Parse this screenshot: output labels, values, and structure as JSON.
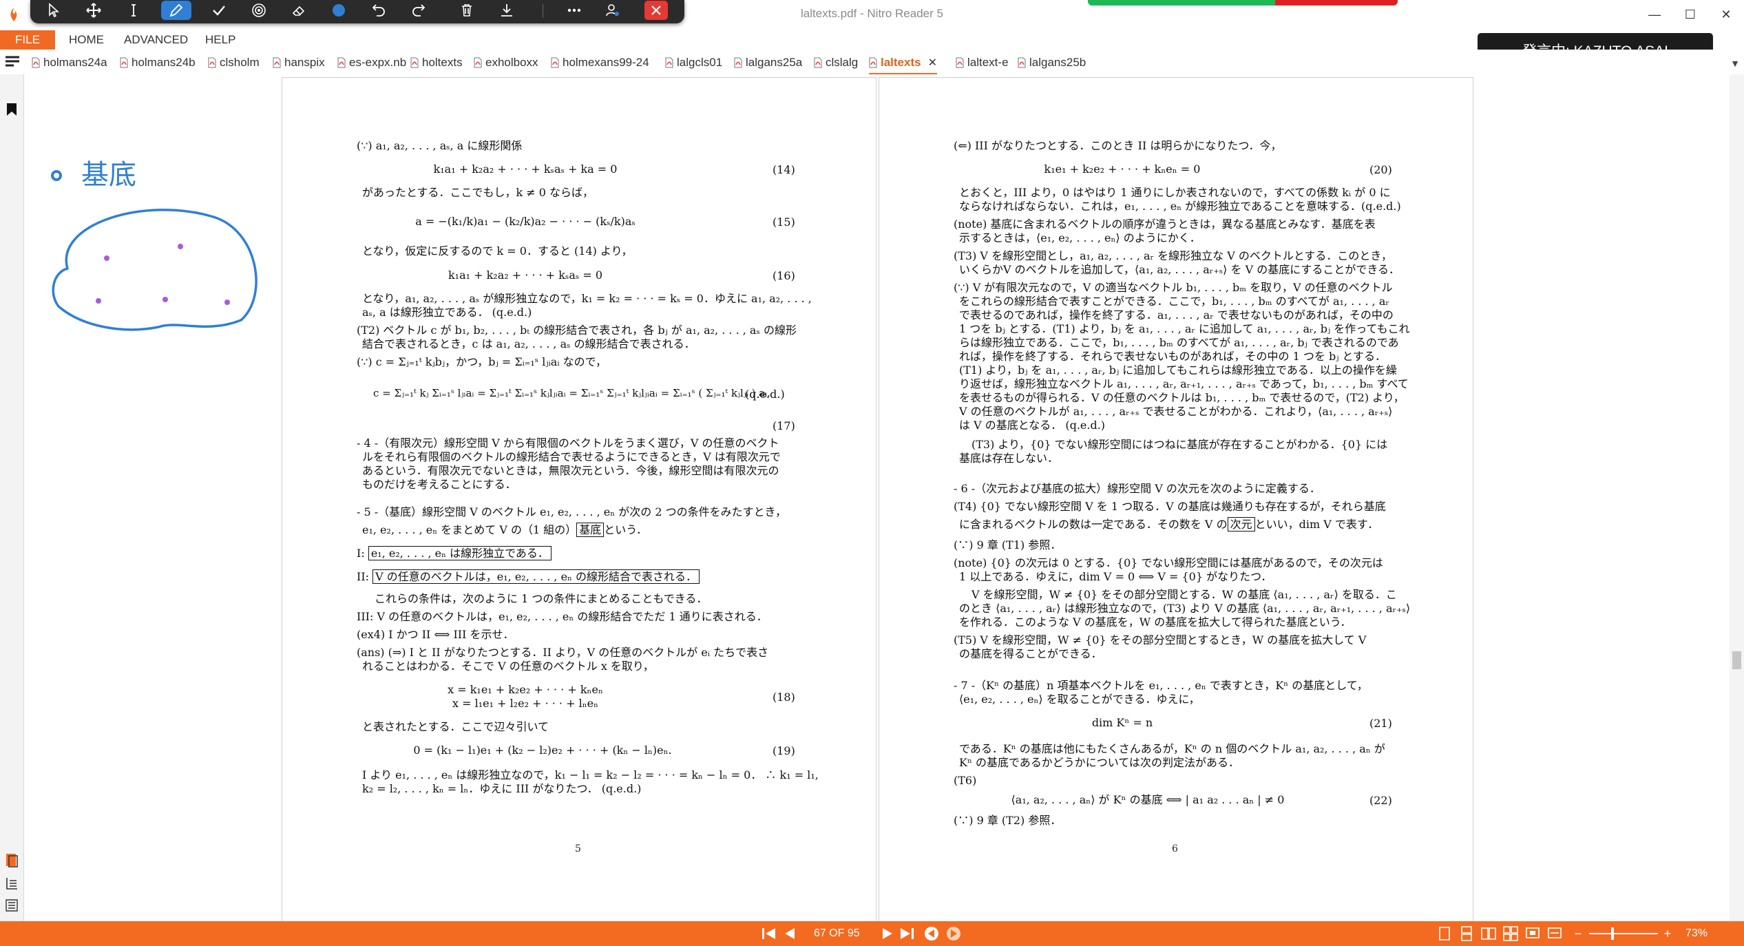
{
  "window": {
    "title": "laltexts.pdf - Nitro Reader 5",
    "min": "—",
    "max": "☐",
    "close": "✕"
  },
  "menu": {
    "file": "FILE",
    "home": "HOME",
    "advanced": "ADVANCED",
    "help": "HELP"
  },
  "tabs": [
    "holmans24a",
    "holmans24b",
    "clsholm",
    "hanspix",
    "es-expx.nb",
    "holtexts",
    "exholboxx",
    "holmexans99-24",
    "lalgcls01",
    "lalgans25a",
    "clslalg",
    "laltexts",
    "laltext-e",
    "lalgans25b"
  ],
  "active_tab": "laltexts",
  "speaker": "発言中: KAZUTO ASAI",
  "annotation": {
    "handwriting": "基底"
  },
  "page5": {
    "l1": "(∵) a₁, a₂, . . . , aₛ, a に線形関係",
    "eq14": "k₁a₁ + k₂a₂ + · · · + kₛaₛ + ka = 0",
    "n14": "(14)",
    "l2": "があったとする．ここでもし，k ≠ 0 ならば，",
    "eq15": "a = −(k₁/k)a₁ − (k₂/k)a₂ − · · · − (kₛ/k)aₛ",
    "n15": "(15)",
    "l3": "となり，仮定に反するので k = 0．すると (14) より，",
    "eq16": "k₁a₁ + k₂a₂ + · · · + kₛaₛ = 0",
    "n16": "(16)",
    "l4": "となり，a₁, a₂, . . . , aₛ が線形独立なので，k₁ = k₂ = · · · = kₛ = 0．ゆえに a₁, a₂, . . . ,",
    "l5": "aₛ, a は線形独立である．  (q.e.d.)",
    "l6": "(T2) ベクトル c が b₁, b₂, . . . , bₜ の線形結合で表され，各 bⱼ が a₁, a₂, . . . , aₛ の線形",
    "l7": "結合で表されるとき，c は a₁, a₂, . . . , aₛ の線形結合で表される．",
    "l8": "(∵) c = Σⱼ₌₁ᵗ kⱼbⱼ，かつ，bⱼ = Σᵢ₌₁ˢ lⱼᵢaᵢ なので，",
    "eq17": "c = Σⱼ₌₁ᵗ kⱼ Σᵢ₌₁ˢ lⱼᵢaᵢ = Σⱼ₌₁ᵗ Σᵢ₌₁ˢ kⱼlⱼᵢaᵢ = Σᵢ₌₁ˢ Σⱼ₌₁ᵗ kⱼlⱼᵢaᵢ = Σᵢ₌₁ˢ ( Σⱼ₌₁ᵗ kⱼlⱼᵢ ) aᵢ.",
    "qed17": "(q.e.d.)",
    "n17": "(17)",
    "s4a": "- 4 -（有限次元）線形空間 V から有限個のベクトルをうまく選び，V の任意のベクト",
    "s4b": "ルをそれら有限個のベクトルの線形結合で表せるようにできるとき，V は有限次元で",
    "s4c": "あるという．有限次元でないときは，無限次元という．今後，線形空間は有限次元の",
    "s4d": "ものだけを考えることにする．",
    "s5a": "- 5 -（基底）線形空間 V のベクトル e₁, e₂, . . . , eₙ が次の 2 つの条件をみたすとき，",
    "s5b_pre": "e₁, e₂, . . . , eₙ をまとめて V の（1 組の）",
    "s5b_box": "基底",
    "s5b_post": "という．",
    "cI_label": "I:",
    "cI_box": "e₁, e₂, . . . , eₙ は線形独立である．",
    "cII_label": "II:",
    "cII_box": "V の任意のベクトルは，e₁, e₂, . . . , eₙ の線形結合で表される．",
    "l9": "これらの条件は，次のように 1 つの条件にまとめることもできる．",
    "l10": "III: V の任意のベクトルは，e₁, e₂, . . . , eₙ の線形結合でただ 1 通りに表される．",
    "l11": "(ex4) I かつ II ⟺ III  を示せ．",
    "l12": "(ans) (⇒) I と II がなりたつとする．II より，V の任意のベクトルが eᵢ たちで表さ",
    "l13": "れることはわかる．そこで V の任意のベクトル x を取り，",
    "eq18a": "x = k₁e₁ + k₂e₂ + · · · + kₙeₙ",
    "eq18b": "x = l₁e₁ + l₂e₂ + · · · + lₙeₙ",
    "n18": "(18)",
    "l14": "と表されたとする．ここで辺々引いて",
    "eq19": "0 = (k₁ − l₁)e₁ + (k₂ − l₂)e₂ + · · · + (kₙ − lₙ)eₙ.",
    "n19": "(19)",
    "l15": "I より e₁, . . . , eₙ は線形独立なので，k₁ − l₁ = k₂ − l₂ = · · · = kₙ − lₙ = 0．  ∴ k₁ = l₁,",
    "l16": "k₂ = l₂,  . . . ,  kₙ = lₙ．ゆえに III がなりたつ．  (q.e.d.)",
    "num": "5"
  },
  "page6": {
    "l1": "(⇐) III がなりたつとする．このとき II は明らかになりたつ．今，",
    "eq20": "k₁e₁ + k₂e₂ + · · · + kₙeₙ = 0",
    "n20": "(20)",
    "l2": "とおくと，III より，0 はやはり 1 通りにしか表されないので，すべての係数 kᵢ が 0 に",
    "l3": "ならなければならない．これは，e₁, . . . , eₙ が線形独立であることを意味する．(q.e.d.)",
    "l4": "(note) 基底に含まれるベクトルの順序が違うときは，異なる基底とみなす．基底を表",
    "l5": "示するときは，⟨e₁, e₂, . . . , eₙ⟩ のようにかく．",
    "l6": "(T3) V を線形空間とし，a₁, a₂, . . . , aᵣ を線形独立な V のベクトルとする．このとき，",
    "l7": "いくらかV のベクトルを追加して，⟨a₁, a₂, . . . , aᵣ₊ₛ⟩ を V の基底にすることができる．",
    "l8": "(∵) V が有限次元なので，V の適当なベクトル b₁, . . . , bₘ を取り，V の任意のベクトル",
    "l9": "をこれらの線形結合で表すことができる．ここで，b₁, . . . , bₘ のすべてが a₁, . . . , aᵣ",
    "l10": "で表せるのであれば，操作を終了する．a₁, . . . , aᵣ で表せないものがあれば，その中の",
    "l11": "1 つを bⱼ とする．(T1) より，bⱼ を a₁, . . . , aᵣ に追加して a₁, . . . , aᵣ, bⱼ を作ってもこれ",
    "l12": "らは線形独立である．ここで，b₁, . . . , bₘ のすべてが a₁, . . . , aᵣ, bⱼ で表されるのであ",
    "l13": "れば，操作を終了する．それらで表せないものがあれば，その中の 1 つを bⱼ とする．",
    "l14": "(T1) より，bⱼ を a₁, . . . , aᵣ, bⱼ に追加してもこれらは線形独立である．以上の操作を繰",
    "l15": "り返せば，線形独立なベクトル a₁, . . . , aᵣ, aᵣ₊₁, . . . , aᵣ₊ₛ であって，b₁, . . . , bₘ すべて",
    "l16": "を表せるものが得られる．V の任意のベクトルは b₁, . . . , bₘ で表せるので，(T2) より，",
    "l17": "V の任意のベクトルが a₁, . . . , aᵣ₊ₛ で表せることがわかる．これより，⟨a₁, . . . , aᵣ₊ₛ⟩",
    "l18": "は V の基底となる．  (q.e.d.)",
    "l19": "(T3) より，{0} でない線形空間にはつねに基底が存在することがわかる．{0} には",
    "l20": "基底は存在しない．",
    "s6": "- 6 -（次元および基底の拡大）線形空間 V の次元を次のように定義する．",
    "l21": "(T4) {0} でない線形空間 V を 1 つ取る．V の基底は幾通りも存在するが，それら基底",
    "l22_pre": "に含まれるベクトルの数は一定である．その数を V の",
    "l22_box": "次元",
    "l22_post": "といい，dim V で表す．",
    "l23": "(∵) 9 章 (T1) 参照．",
    "l24": "(note) {0} の次元は 0 とする．{0} でない線形空間には基底があるので，その次元は",
    "l25": "1 以上である．ゆえに，dim V = 0 ⟺ V = {0} がなりたつ．",
    "l26": "V を線形空間，W ≠ {0} をその部分空間とする．W の基底 ⟨a₁, . . . , aᵣ⟩ を取る．こ",
    "l27": "のとき ⟨a₁, . . . , aᵣ⟩ は線形独立なので，(T3) より V の基底 ⟨a₁, . . . , aᵣ, aᵣ₊₁, . . . , aᵣ₊ₛ⟩",
    "l28": "を作れる．このような V の基底を，W の基底を拡大して得られた基底という．",
    "l29": "(T5) V を線形空間，W ≠ {0} をその部分空間とするとき，W の基底を拡大して V",
    "l30": "の基底を得ることができる．",
    "s7a": "- 7 -（Kⁿ の基底）n 項基本ベクトルを e₁, . . . , eₙ で表すとき，Kⁿ の基底として，",
    "s7b": "⟨e₁, e₂, . . . , eₙ⟩ を取ることができる．ゆえに，",
    "eq21": "dim Kⁿ = n",
    "n21": "(21)",
    "l31": "である．Kⁿ の基底は他にもたくさんあるが，Kⁿ の n 個のベクトル a₁, a₂, . . . , aₙ が",
    "l32": "Kⁿ の基底であるかどうかについては次の判定法がある．",
    "l33": "(T6)",
    "eq22": "⟨a₁, a₂, . . . , aₙ⟩ が Kⁿ の基底 ⟺ | a₁  a₂  . . .  aₙ | ≠ 0",
    "n22": "(22)",
    "l34": "(∵) 9 章 (T2) 参照．",
    "num": "6"
  },
  "status": {
    "page_indicator": "67 OF 95",
    "zoom": "73%",
    "zoom_minus": "−",
    "zoom_plus": "+"
  },
  "colors": {
    "accent": "#f26b21",
    "ink": "#2f7fd4",
    "dots": "#a65be0"
  }
}
